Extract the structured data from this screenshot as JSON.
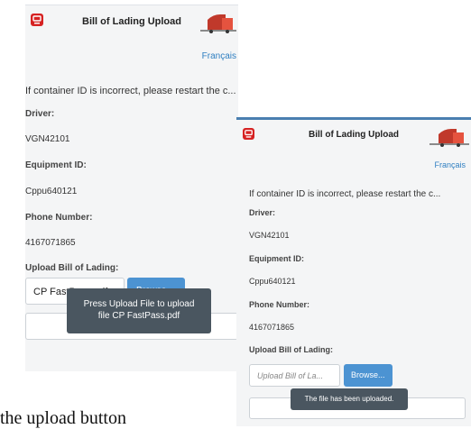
{
  "screen_a": {
    "title": "Bill of Lading Upload",
    "language_link": "Français",
    "notice": "If container ID is incorrect, please restart the c...",
    "driver_label": "Driver:",
    "driver_value": "VGN42101",
    "equipment_label": "Equipment ID:",
    "equipment_value": "Cppu640121",
    "phone_label": "Phone Number:",
    "phone_value": "4167071865",
    "upload_label": "Upload Bill of Lading:",
    "file_value": "CP FastPass.pdf",
    "browse_label": "Browse...",
    "upload_button": "Upload",
    "toast_line1": "Press Upload File to upload",
    "toast_line2": "file CP FastPass.pdf"
  },
  "screen_b": {
    "title": "Bill of Lading Upload",
    "language_link": "Français",
    "notice": "If container ID is incorrect, please restart the c...",
    "driver_label": "Driver:",
    "driver_value": "VGN42101",
    "equipment_label": "Equipment ID:",
    "equipment_value": "Cppu640121",
    "phone_label": "Phone Number:",
    "phone_value": "4167071865",
    "upload_label": "Upload Bill of Lading:",
    "file_placeholder": "Upload Bill of La...",
    "browse_label": "Browse...",
    "toast": "The file has been uploaded."
  },
  "caption": "the upload button",
  "icons": {
    "logo": "company-logo-icon",
    "truck": "truck-icon"
  },
  "colors": {
    "accent": "#4c93d2",
    "link": "#2f7fc1",
    "toast": "#4a5660",
    "logo": "#d62222"
  }
}
